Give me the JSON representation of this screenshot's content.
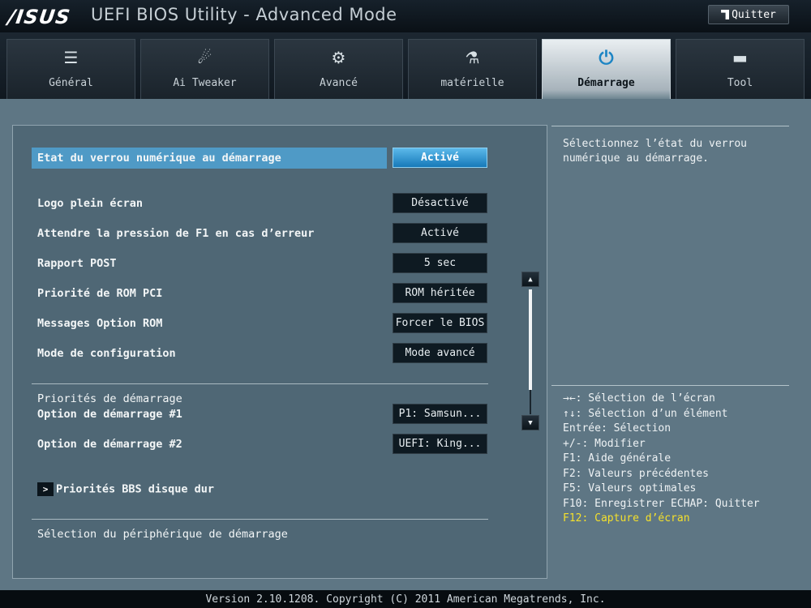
{
  "header": {
    "logo": "/ISUS",
    "title": "UEFI BIOS Utility - Advanced Mode",
    "quit_label": "Quitter"
  },
  "tabs": [
    {
      "label": "Général",
      "icon": "list-icon",
      "glyph": "☰"
    },
    {
      "label": "Ai Tweaker",
      "icon": "tweaker-icon",
      "glyph": "☄"
    },
    {
      "label": "Avancé",
      "icon": "advanced-icon",
      "glyph": "⚙"
    },
    {
      "label": "matérielle",
      "icon": "monitor-icon",
      "glyph": "⚗"
    },
    {
      "label": "Démarrage",
      "icon": "power-icon",
      "glyph": "⏻",
      "active": true
    },
    {
      "label": "Tool",
      "icon": "toolbox-icon",
      "glyph": "▬"
    }
  ],
  "settings": {
    "numlock": {
      "label": "Etat du verrou numérique au démarrage",
      "value": "Activé"
    },
    "logo": {
      "label": "Logo plein écran",
      "value": "Désactivé"
    },
    "f1wait": {
      "label": "Attendre la pression de F1 en cas d’erreur",
      "value": "Activé"
    },
    "post": {
      "label": "Rapport POST",
      "value": "5 sec"
    },
    "pcirom": {
      "label": "Priorité de ROM PCI",
      "value": "ROM héritée"
    },
    "optrom": {
      "label": "Messages Option ROM",
      "value": "Forcer le BIOS"
    },
    "mode": {
      "label": "Mode de configuration",
      "value": "Mode avancé"
    }
  },
  "boot": {
    "section_title": "Priorités de démarrage",
    "opt1": {
      "label": "Option de démarrage #1",
      "value": "P1: Samsun..."
    },
    "opt2": {
      "label": "Option de démarrage #2",
      "value": "UEFI: King..."
    },
    "bbs": "Priorités BBS disque dur",
    "bottom": "Sélection du périphérique de démarrage"
  },
  "help": {
    "description": "Sélectionnez l’état du verrou numérique au démarrage.",
    "keys": [
      "→←: Sélection de l’écran",
      "↑↓: Sélection d’un élément",
      "Entrée: Sélection",
      "+/-: Modifier",
      "F1: Aide générale",
      "F2: Valeurs précédentes",
      "F5: Valeurs optimales",
      "F10: Enregistrer  ECHAP: Quitter"
    ],
    "key_highlight": "F12: Capture d’écran"
  },
  "footer": "Version 2.10.1208. Copyright (C) 2011 American Megatrends, Inc.",
  "colors": {
    "accent": "#1d85c4",
    "highlight_row": "#4f9ac6",
    "key_yellow": "#f4e02c"
  }
}
